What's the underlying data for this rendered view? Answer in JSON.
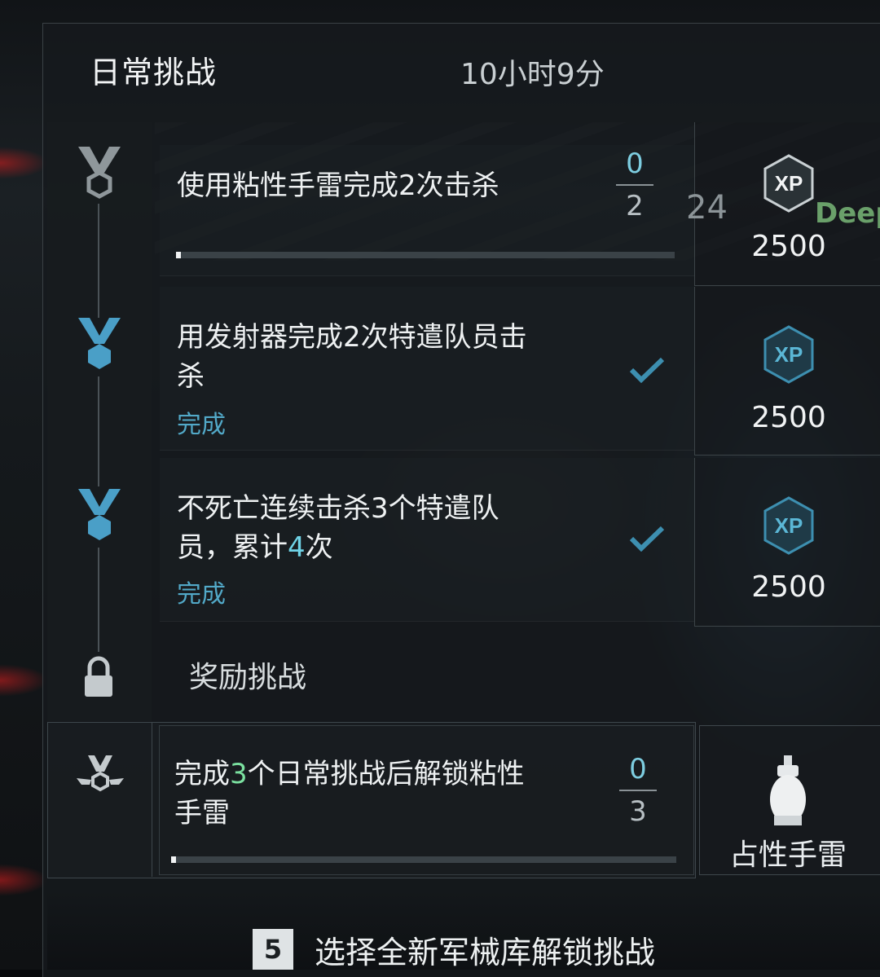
{
  "header": {
    "title": "日常挑战",
    "timer": "10小时9分"
  },
  "background": {
    "stray_number": "24",
    "stray_tag": "Deep"
  },
  "challenges": [
    {
      "title": "使用粘性手雷完成2次击杀",
      "status": "",
      "progress_current": "0",
      "progress_target": "2",
      "progress_fraction": 0.0,
      "reward_xp": "2500",
      "completed": false
    },
    {
      "title_line1": "用发射器完成2次特遣队员击",
      "title_line2": "杀",
      "status": "完成",
      "reward_xp": "2500",
      "completed": true
    },
    {
      "title_line1_a": "不死亡连续击杀3个特遣队",
      "title_line2_a": "员，累计",
      "title_line2_hl": "4",
      "title_line2_b": "次",
      "status": "完成",
      "reward_xp": "2500",
      "completed": true
    }
  ],
  "bonus": {
    "section_label": "奖励挑战",
    "title_a": "完成",
    "title_hl": "3",
    "title_b": "个日常挑战后解锁粘性",
    "title_line2": "手雷",
    "progress_current": "0",
    "progress_target": "3",
    "progress_fraction": 0.0,
    "reward_label": "占性手雷",
    "reward_icon": "grenade-icon"
  },
  "footer": {
    "key": "5",
    "text": "选择全新军械库解锁挑战"
  },
  "colors": {
    "accent": "#52a9c8",
    "xp_badge": "#3d8fb0",
    "medal_done": "#4a9fc7",
    "medal_pending": "#8f979b"
  },
  "xp_badge_label": "XP"
}
